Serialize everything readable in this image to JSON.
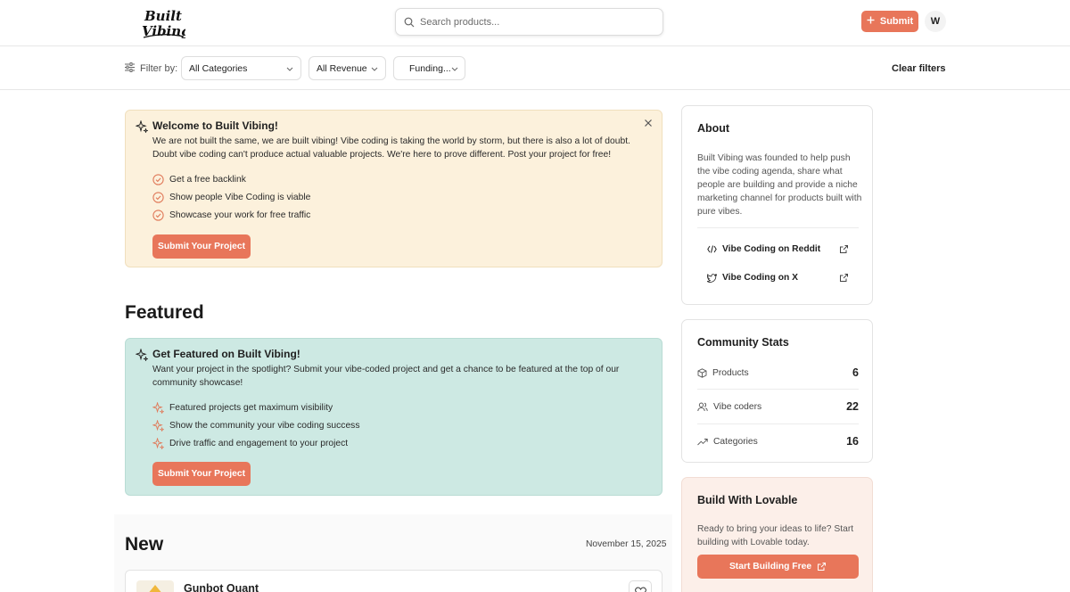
{
  "header": {
    "logo_alt": "Built Vibing",
    "search": {
      "placeholder": "Search products..."
    },
    "submit_label": "Submit",
    "avatar_initial": "W"
  },
  "filters": {
    "label": "Filter by:",
    "categories": "All Categories",
    "revenue": "All Revenue",
    "funding": "Funding...",
    "clear_label": "Clear filters"
  },
  "welcome": {
    "title": "Welcome to Built Vibing!",
    "body": "We are not built the same, we are built vibing! Vibe coding is taking the world by storm, but there is also a lot of doubt. Doubt vibe coding can't produce actual valuable projects. We're here to prove different. Post your project for free!",
    "bullets": [
      "Get a free backlink",
      "Show people Vibe Coding is viable",
      "Showcase your work for free traffic"
    ],
    "cta": "Submit Your Project"
  },
  "featured": {
    "heading": "Featured",
    "title": "Get Featured on Built Vibing!",
    "body": "Want your project in the spotlight? Submit your vibe-coded project and get a chance to be featured at the top of our community showcase!",
    "bullets": [
      "Featured projects get maximum visibility",
      "Show the community your vibe coding success",
      "Drive traffic and engagement to your project"
    ],
    "cta": "Submit Your Project"
  },
  "new_section": {
    "heading": "New",
    "date": "November 15, 2025",
    "product_name": "Gunbot Quant"
  },
  "about": {
    "title": "About",
    "text": "Built Vibing was founded to help push the vibe coding agenda, share what people are building and provide a niche marketing channel for products built with pure vibes.",
    "links": [
      "Vibe Coding on Reddit",
      "Vibe Coding on X"
    ]
  },
  "stats": {
    "title": "Community Stats",
    "rows": [
      {
        "label": "Products",
        "value": "6"
      },
      {
        "label": "Vibe coders",
        "value": "22"
      },
      {
        "label": "Categories",
        "value": "16"
      }
    ]
  },
  "lovable": {
    "title": "Build With Lovable",
    "text": "Ready to bring your ideas to life? Start building with Lovable today.",
    "cta": "Start Building Free"
  },
  "colors": {
    "accent": "#e8765a",
    "welcome_bg": "#fcf1dc",
    "featured_bg": "#cde9e3",
    "lovable_bg": "#fcefe9"
  }
}
